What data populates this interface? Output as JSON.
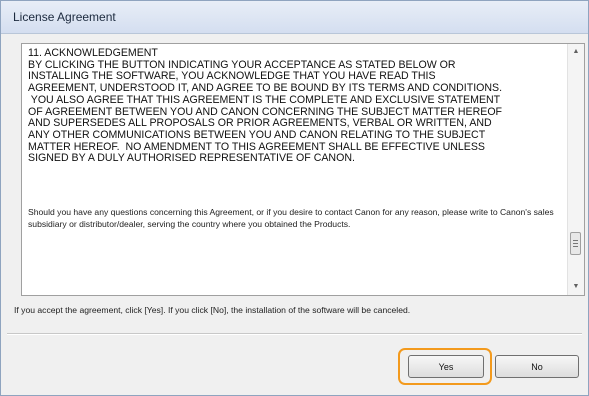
{
  "window": {
    "title": "License Agreement"
  },
  "agreement": {
    "legal_lines": [
      "11.  ACKNOWLEDGEMENT",
      "BY CLICKING THE BUTTON INDICATING YOUR ACCEPTANCE AS STATED BELOW OR",
      "INSTALLING THE SOFTWARE, YOU ACKNOWLEDGE THAT YOU HAVE READ THIS",
      "AGREEMENT, UNDERSTOOD IT, AND AGREE TO BE BOUND BY ITS TERMS AND CONDITIONS.",
      " YOU ALSO AGREE THAT THIS AGREEMENT IS THE COMPLETE AND EXCLUSIVE STATEMENT",
      "OF AGREEMENT BETWEEN YOU AND CANON CONCERNING THE SUBJECT MATTER HEREOF",
      "AND SUPERSEDES ALL PROPOSALS OR PRIOR AGREEMENTS, VERBAL OR WRITTEN, AND",
      "ANY OTHER COMMUNICATIONS BETWEEN YOU AND CANON RELATING TO THE SUBJECT",
      "MATTER HEREOF.  NO AMENDMENT TO THIS AGREEMENT SHALL BE EFFECTIVE UNLESS",
      "SIGNED BY A DULY AUTHORISED REPRESENTATIVE OF CANON."
    ],
    "contact_text": "Should you have any questions concerning this Agreement, or if you desire to contact Canon for any reason, please write to Canon's sales subsidiary or distributor/dealer, serving the country where you obtained the Products.",
    "scroll_position": 0.88
  },
  "hint_text": "If you accept the agreement, click [Yes]. If you click [No], the installation of the software will be canceled.",
  "buttons": {
    "yes_label": "Yes",
    "no_label": "No"
  },
  "colors": {
    "highlight": "#f39a1d"
  }
}
